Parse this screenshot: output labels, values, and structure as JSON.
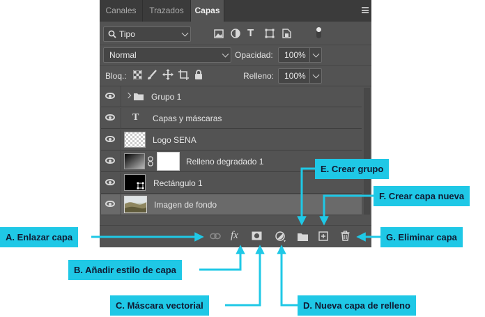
{
  "tabs": [
    {
      "label": "Canales",
      "active": false
    },
    {
      "label": "Trazados",
      "active": false
    },
    {
      "label": "Capas",
      "active": true
    }
  ],
  "filter": {
    "selected": "Tipo"
  },
  "blend": {
    "mode": "Normal",
    "opacity_label": "Opacidad:",
    "opacity_value": "100%"
  },
  "lock": {
    "label": "Bloq.:",
    "fill_label": "Relleno:",
    "fill_value": "100%"
  },
  "layers": [
    {
      "name": "Grupo 1",
      "kind": "group"
    },
    {
      "name": "Capas y máscaras",
      "kind": "text"
    },
    {
      "name": "Logo SENA",
      "kind": "image-transparent"
    },
    {
      "name": "Relleno degradado 1",
      "kind": "gradient-fill"
    },
    {
      "name": "Rectángulo 1",
      "kind": "shape"
    },
    {
      "name": "Imagen de fondo",
      "kind": "photo",
      "selected": true
    }
  ],
  "callouts": {
    "a": "A. Enlazar capa",
    "b": "B. Añadir estilo de capa",
    "c": "C. Máscara vectorial",
    "d": "D. Nueva capa de relleno",
    "e": "E. Crear grupo",
    "f": "F. Crear capa nueva",
    "g": "G. Eliminar capa"
  },
  "colors": {
    "accent": "#1fc8e6",
    "panel": "#535353",
    "callout_text": "#0f1b33"
  }
}
